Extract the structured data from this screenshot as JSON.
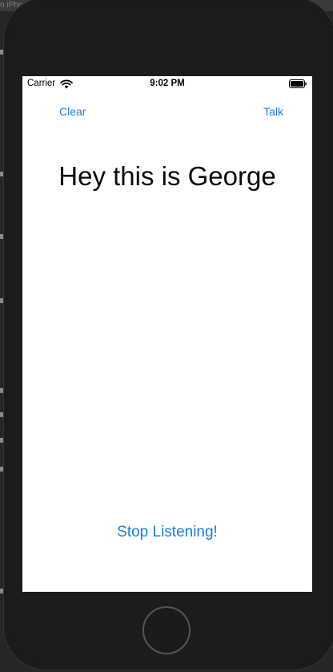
{
  "backdrop": {
    "crumb": "n iPho"
  },
  "status_bar": {
    "carrier": "Carrier",
    "time": "9:02 PM",
    "wifi_icon": "wifi-icon",
    "battery_icon": "battery-full-icon"
  },
  "nav": {
    "clear_label": "Clear",
    "talk_label": "Talk"
  },
  "main": {
    "transcript": "Hey this is George",
    "stop_label": "Stop Listening!"
  },
  "colors": {
    "accent": "#1a7ddb",
    "screen_bg": "#ffffff",
    "device_bg": "#1b1b1b"
  }
}
